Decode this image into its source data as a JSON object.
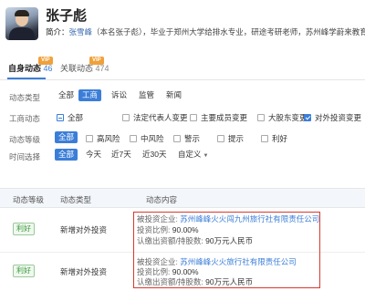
{
  "profile": {
    "name": "张子彪",
    "bio_label": "简介：",
    "bio_name": "张雪峰",
    "bio_text": "（本名张子彪），毕业于郑州大学给排水专业，研途考研老师，苏州峰学蔚来教育科技有限"
  },
  "tabs": [
    {
      "label": "自身动态",
      "count": "46",
      "vip": "VIP",
      "active": true
    },
    {
      "label": "关联动态",
      "count": "474",
      "vip": "VIP",
      "active": false
    }
  ],
  "filters": {
    "type": {
      "label": "动态类型",
      "options": [
        "全部",
        "工商",
        "诉讼",
        "监管",
        "新闻"
      ],
      "selected": "工商"
    },
    "business": {
      "label": "工商动态",
      "options": [
        "全部",
        "法定代表人变更",
        "主要成员变更",
        "大股东变更",
        "对外投资变更"
      ],
      "checked": [
        "对外投资变更"
      ],
      "partial": "全部"
    },
    "level": {
      "label": "动态等级",
      "options": [
        "全部",
        "高风险",
        "中风险",
        "警示",
        "提示",
        "利好"
      ],
      "selected": "全部"
    },
    "time": {
      "label": "时间选择",
      "options": [
        "全部",
        "今天",
        "近7天",
        "近30天",
        "自定义"
      ],
      "selected": "全部"
    }
  },
  "table": {
    "headers": [
      "动态等级",
      "动态类型",
      "动态内容"
    ],
    "rows": [
      {
        "level": "利好",
        "type": "新增对外投资",
        "company_label": "被投资企业:",
        "company": "苏州峰峰火火闯九州旅行社有限责任公司",
        "ratio_label": "投资比例:",
        "ratio": "90.00%",
        "capital_label": "认缴出资额/持股数:",
        "capital": "90万元人民币"
      },
      {
        "level": "利好",
        "type": "新增对外投资",
        "company_label": "被投资企业:",
        "company": "苏州峰峰火火旅行社有限责任公司",
        "ratio_label": "投资比例:",
        "ratio": "90.00%",
        "capital_label": "认缴出资额/持股数:",
        "capital": "90万元人民币"
      }
    ]
  },
  "colors": {
    "accent": "#3b7ed8",
    "positive": "#3c9a3c",
    "highlight": "#d9372d",
    "vip": "#f0a13b"
  }
}
